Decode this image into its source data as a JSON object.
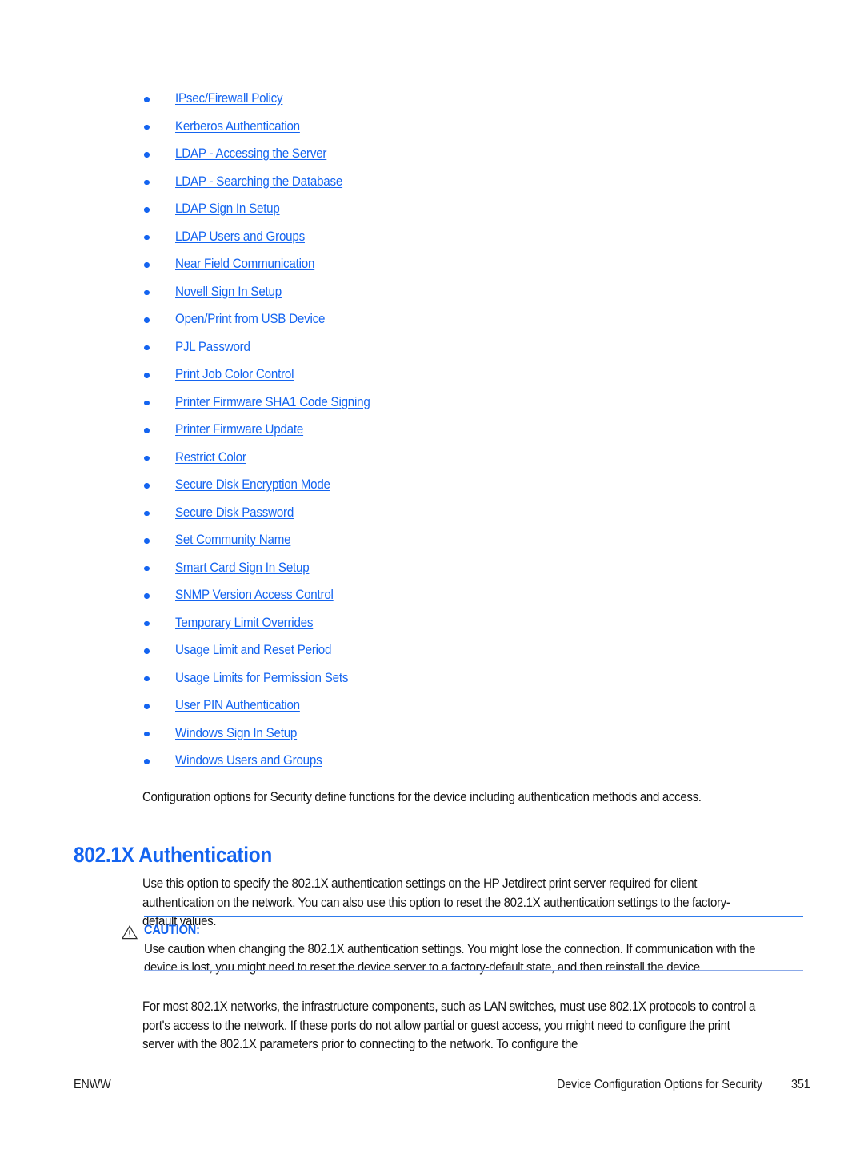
{
  "document": {
    "links": [
      {
        "label": "IPsec/Firewall Policy"
      },
      {
        "label": "Kerberos Authentication"
      },
      {
        "label": "LDAP - Accessing the Server"
      },
      {
        "label": "LDAP - Searching the Database"
      },
      {
        "label": "LDAP Sign In Setup"
      },
      {
        "label": "LDAP Users and Groups"
      },
      {
        "label": "Near Field Communication"
      },
      {
        "label": "Novell Sign In Setup"
      },
      {
        "label": "Open/Print from USB Device"
      },
      {
        "label": "PJL Password"
      },
      {
        "label": "Print Job Color Control"
      },
      {
        "label": "Printer Firmware SHA1 Code Signing"
      },
      {
        "label": "Printer Firmware Update"
      },
      {
        "label": "Restrict Color"
      },
      {
        "label": "Secure Disk Encryption Mode"
      },
      {
        "label": "Secure Disk Password"
      },
      {
        "label": "Set Community Name"
      },
      {
        "label": "Smart Card Sign In Setup"
      },
      {
        "label": "SNMP Version Access Control"
      },
      {
        "label": "Temporary Limit Overrides"
      },
      {
        "label": "Usage Limit and Reset Period"
      },
      {
        "label": "Usage Limits for Permission Sets"
      },
      {
        "label": "User PIN Authentication"
      },
      {
        "label": "Windows Sign In Setup"
      },
      {
        "label": "Windows Users and Groups"
      }
    ],
    "intro_paragraph": "Configuration options for Security define functions for the device including authentication methods and access.",
    "heading": "802.1X Authentication",
    "description_paragraph": "Use this option to specify the 802.1X authentication settings on the HP Jetdirect print server required for client authentication on the network. You can also use this option to reset the 802.1X authentication settings to the factory-default values.",
    "caution": {
      "icon": "warning-triangle-icon",
      "label": "CAUTION:",
      "text": "Use caution when changing the 802.1X authentication settings. You might lose the connection. If communication with the device is lost, you might need to reset the device server to a factory-default state, and then reinstall the device."
    },
    "closing_paragraph": "For most 802.1X networks, the infrastructure components, such as LAN switches, must use 802.1X protocols to control a port's access to the network. If these ports do not allow partial or guest access, you might need to configure the print server with the 802.1X parameters prior to connecting to the network. To configure the",
    "footer": {
      "left": "ENWW",
      "right": "Device Configuration Options for Security",
      "page_number": "351"
    },
    "colors": {
      "link": "#1464f0",
      "heading": "#1464f0",
      "bullet": "#1464f0",
      "rule_top": "#2f7ced",
      "rule_bottom": "#8ba9e8",
      "body_text": "#131313"
    }
  }
}
